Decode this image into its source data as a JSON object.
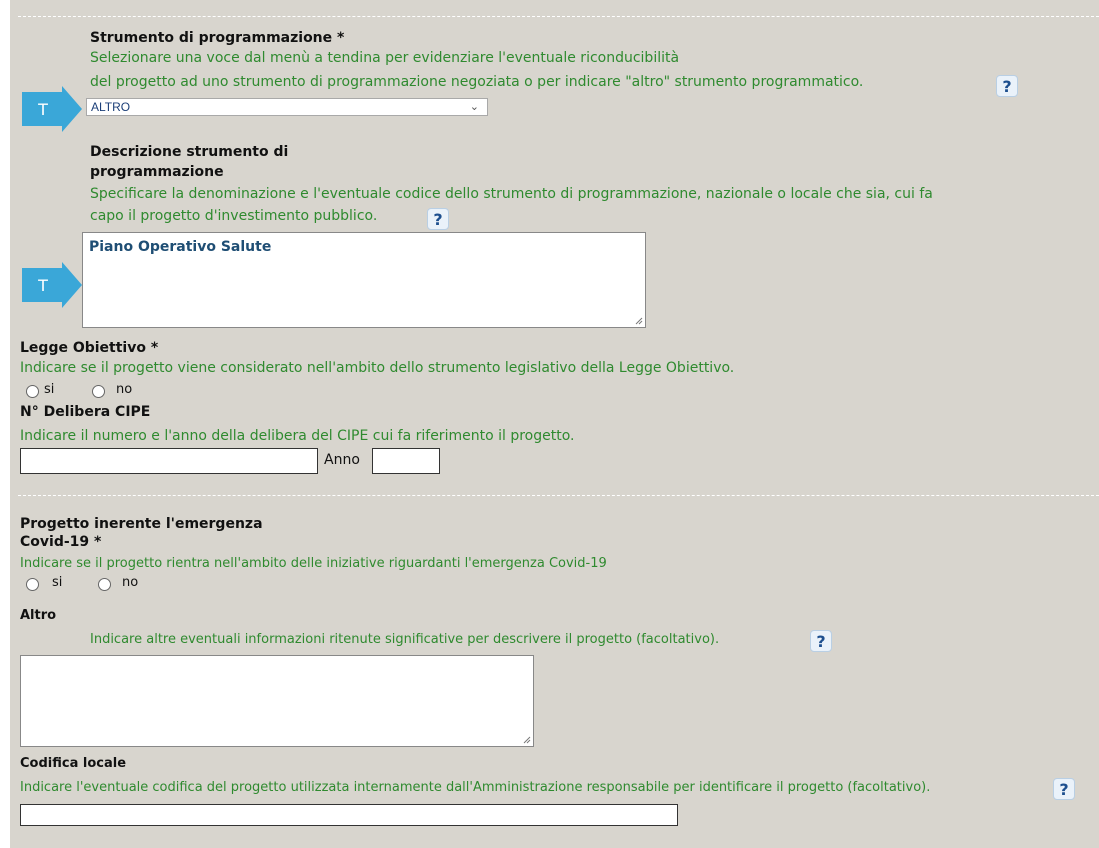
{
  "strumento": {
    "label": "Strumento di programmazione *",
    "hint_line1": "Selezionare una voce dal menù a tendina per evidenziare l'eventuale riconducibilità",
    "hint_line2": "del progetto ad uno strumento di programmazione negoziata o per indicare \"altro\" strumento programmatico.",
    "selected": "ALTRO"
  },
  "descrizione": {
    "label_line1": "Descrizione strumento di",
    "label_line2": "programmazione",
    "hint_line1": "Specificare la denominazione e l'eventuale codice dello strumento di programmazione, nazionale o locale che sia, cui fa",
    "hint_line2": "capo il progetto d'investimento pubblico.",
    "value": "Piano Operativo Salute"
  },
  "legge": {
    "label": "Legge Obiettivo *",
    "hint": "Indicare se il progetto viene considerato nell'ambito dello strumento legislativo della Legge Obiettivo.",
    "opt_si": "si",
    "opt_no": "no"
  },
  "delibera": {
    "label": "N° Delibera CIPE",
    "hint": "Indicare il numero e l'anno della delibera del CIPE cui fa riferimento il progetto.",
    "anno_label": "Anno"
  },
  "covid": {
    "label_line1": "Progetto inerente l'emergenza",
    "label_line2": "Covid-19 *",
    "hint": "Indicare se il progetto rientra nell'ambito delle iniziative riguardanti l'emergenza Covid-19",
    "opt_si": "si",
    "opt_no": "no"
  },
  "altro": {
    "label": "Altro",
    "hint": "Indicare altre eventuali informazioni ritenute significative per descrivere il progetto (facoltativo)."
  },
  "codifica": {
    "label": "Codifica locale",
    "hint": "Indicare l'eventuale codifica del progetto utilizzata internamente dall'Amministrazione responsabile per identificare il progetto (facoltativo)."
  },
  "icons": {
    "help": "?",
    "tutorial_marker": "T"
  },
  "colors": {
    "background": "#d8d5ce",
    "hint_text": "#2f8a2f",
    "marker_arrow": "#3aa7d8",
    "help_icon": "#1d4f8e"
  }
}
